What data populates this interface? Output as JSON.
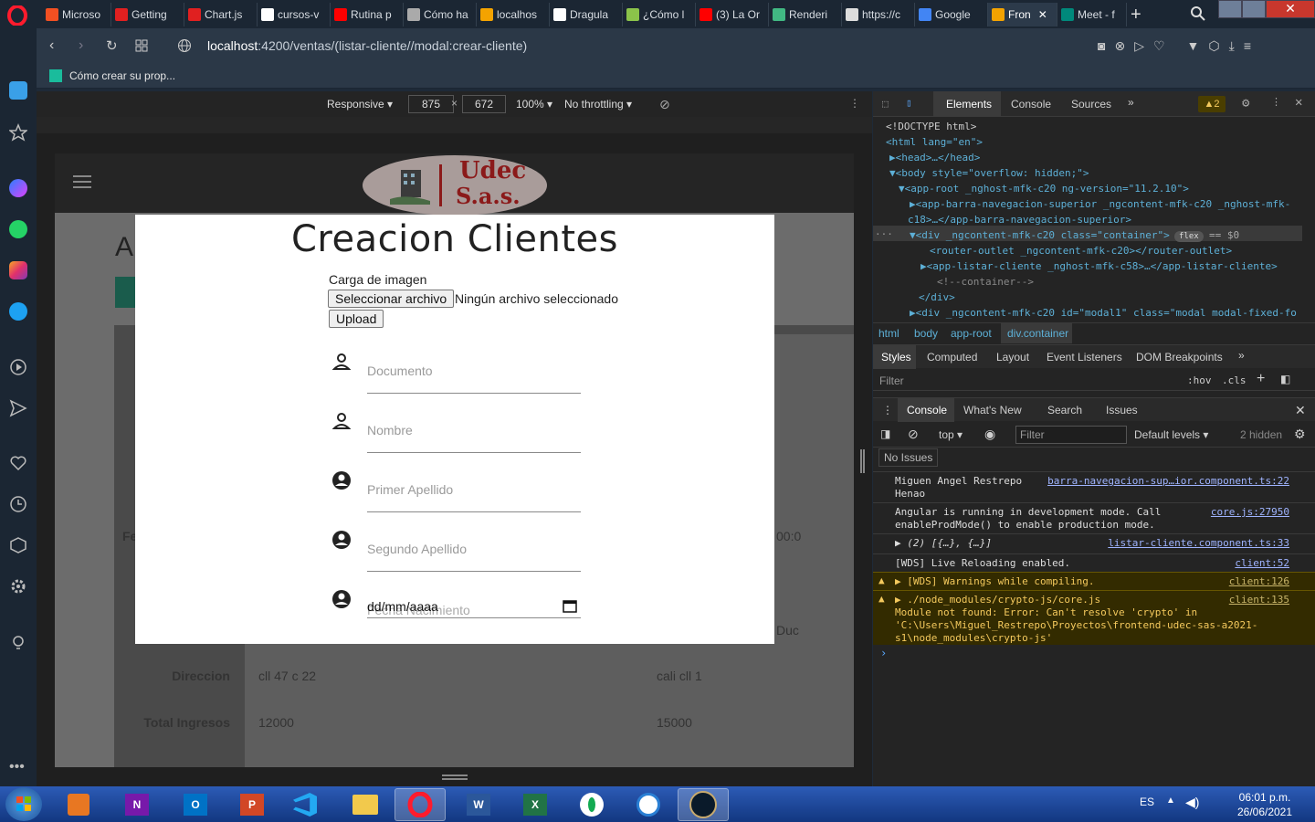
{
  "browser": {
    "tabs": [
      {
        "label": "Microso",
        "color": "#f25022"
      },
      {
        "label": "Getting",
        "color": "#e02020"
      },
      {
        "label": "Chart.js",
        "color": "#e02020"
      },
      {
        "label": "cursos-v",
        "color": "#ffffff"
      },
      {
        "label": "Rutina p",
        "color": "#ff0000"
      },
      {
        "label": "Cómo ha",
        "color": "#aaaaaa"
      },
      {
        "label": "localhos",
        "color": "#f4a300"
      },
      {
        "label": "Dragula",
        "color": "#ffffff"
      },
      {
        "label": "¿Cómo l",
        "color": "#8bc34a"
      },
      {
        "label": "(3) La Or",
        "color": "#ff0000"
      },
      {
        "label": "Renderi",
        "color": "#41b883"
      },
      {
        "label": "https://c",
        "color": "#dddddd"
      },
      {
        "label": "Google",
        "color": "#4285f4"
      },
      {
        "label": "Fron",
        "color": "#f4a300",
        "active": true
      },
      {
        "label": "Meet - f",
        "color": "#00897b"
      }
    ],
    "url_host": "localhost",
    "url_path": ":4200/ventas/(listar-cliente//modal:crear-cliente)",
    "bookmark": "Cómo crear su prop..."
  },
  "device_toolbar": {
    "mode": "Responsive",
    "width": "875",
    "height": "672",
    "zoom": "100%",
    "throttling": "No throttling"
  },
  "app": {
    "logo_line1": "Udec",
    "logo_line2": "S.a.s.",
    "page_initial": "A",
    "rows": [
      {
        "label": "Direccion",
        "col1": "cll 47 c 22",
        "col2": "cali cll 1"
      },
      {
        "label": "Total Ingresos",
        "col1": "12000",
        "col2": "15000"
      }
    ],
    "partial_label_fe": "Fe",
    "partial_time": "00:0",
    "partial_duc": "Duc"
  },
  "modal": {
    "title": "Creacion Clientes",
    "upload_label": "Carga de imagen",
    "choose_file": "Seleccionar archivo",
    "no_file": "Ningún archivo seleccionado",
    "upload_button": "Upload",
    "fields": {
      "documento": "Documento",
      "nombre": "Nombre",
      "primer_apellido": "Primer Apellido",
      "segundo_apellido": "Segundo Apellido",
      "fecha_placeholder": "Fecha Nacimiento",
      "fecha_value": "dd/mm/aaaa"
    }
  },
  "devtools": {
    "tabs": [
      "Elements",
      "Console",
      "Sources"
    ],
    "warn_count": "2",
    "dom": [
      "<!DOCTYPE html>",
      "<html lang=\"en\">",
      "▶<head>…</head>",
      "▼<body style=\"overflow: hidden;\">",
      "▼<app-root _nghost-mfk-c20 ng-version=\"11.2.10\">",
      "▶<app-barra-navegacion-superior _ngcontent-mfk-c20 _nghost-mfk-",
      "c18>…</app-barra-navegacion-superior>",
      "▼<div _ngcontent-mfk-c20 class=\"container\">",
      "<router-outlet _ngcontent-mfk-c20></router-outlet>",
      "▶<app-listar-cliente _nghost-mfk-c58>…</app-listar-cliente>",
      "<!--container-->",
      "</div>",
      "▶<div _ngcontent-mfk-c20 id=\"modal1\" class=\"modal modal-fixed-fo"
    ],
    "flex_badge": "flex",
    "selected_suffix": "== $0",
    "breadcrumb": [
      "html",
      "body",
      "app-root",
      "div.container"
    ],
    "style_tabs": [
      "Styles",
      "Computed",
      "Layout",
      "Event Listeners",
      "DOM Breakpoints"
    ],
    "filter_placeholder": "Filter",
    "hov": ":hov",
    "cls": ".cls",
    "drawer_tabs": [
      "Console",
      "What's New",
      "Search",
      "Issues"
    ],
    "context": "top",
    "console_filter": "Filter",
    "levels": "Default levels",
    "hidden": "2 hidden",
    "no_issues": "No Issues",
    "logs": [
      {
        "text": "Miguen Angel Restrepo\nHenao",
        "src": "barra-navegacion-sup…ior.component.ts:22"
      },
      {
        "text": "Angular is running in development mode. Call\nenableProdMode() to enable production mode.",
        "src": "core.js:27950"
      },
      {
        "text": "▶ (2) [{…}, {…}]",
        "src": "listar-cliente.component.ts:33"
      },
      {
        "text": "[WDS] Live Reloading enabled.",
        "src": "client:52"
      },
      {
        "text": "▶ [WDS] Warnings while compiling.",
        "src": "client:126",
        "warn": true
      },
      {
        "text": "▶ ./node_modules/crypto-js/core.js\nModule not found: Error: Can't resolve 'crypto' in\n'C:\\Users\\Miguel_Restrepo\\Proyectos\\frontend-udec-sas-a2021-\ns1\\node_modules\\crypto-js'",
        "src": "client:135",
        "warn": true
      }
    ]
  },
  "taskbar": {
    "lang": "ES",
    "time": "06:01 p.m.",
    "date": "26/06/2021"
  }
}
